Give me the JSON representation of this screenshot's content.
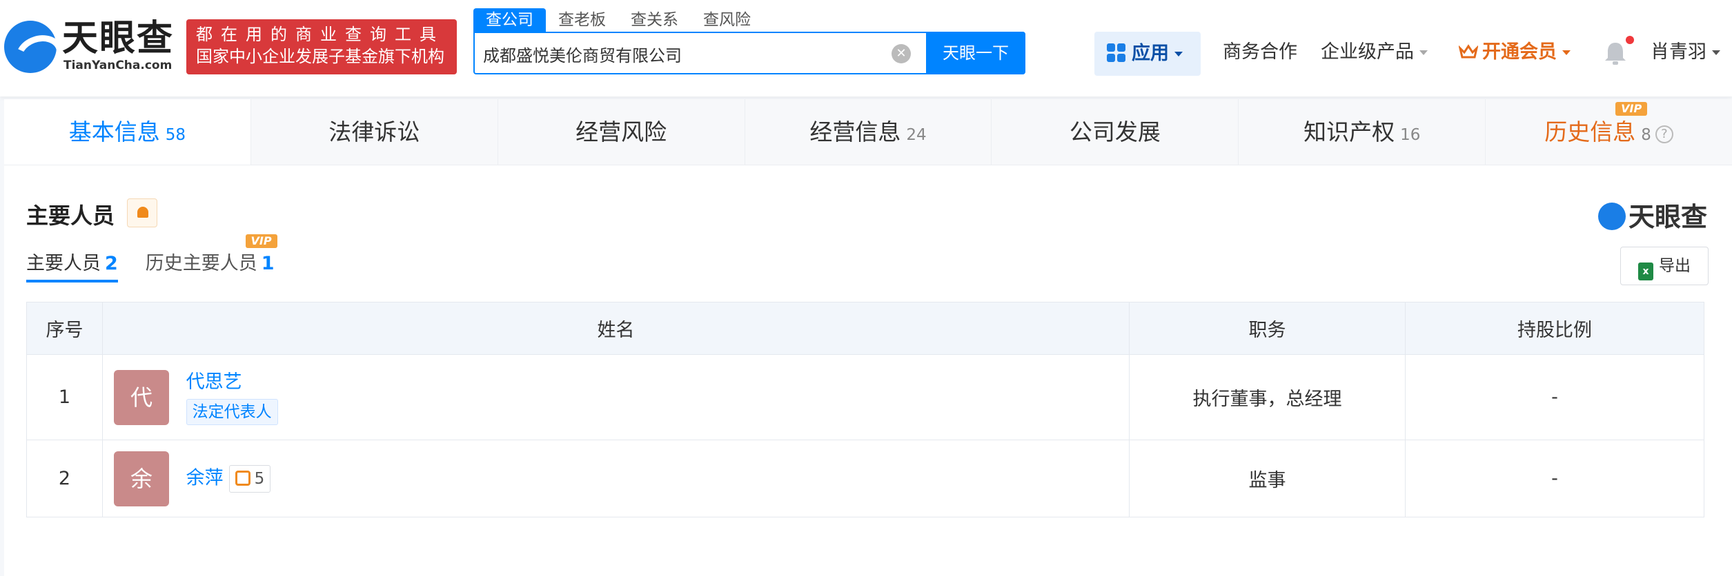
{
  "header": {
    "logo_text": "天眼查",
    "logo_sub": "TianYanCha.com",
    "banner_line1": "都在用的商业查询工具",
    "banner_line2": "国家中小企业发展子基金旗下机构",
    "search_tabs": [
      "查公司",
      "查老板",
      "查关系",
      "查风险"
    ],
    "search_value": "成都盛悦美伦商贸有限公司",
    "search_button": "天眼一下",
    "nav": {
      "apps": "应用",
      "business": "商务合作",
      "enterprise": "企业级产品",
      "vip": "开通会员",
      "user": "肖青羽"
    }
  },
  "tabs": [
    {
      "label": "基本信息",
      "count": "58"
    },
    {
      "label": "法律诉讼",
      "count": ""
    },
    {
      "label": "经营风险",
      "count": ""
    },
    {
      "label": "经营信息",
      "count": "24"
    },
    {
      "label": "公司发展",
      "count": ""
    },
    {
      "label": "知识产权",
      "count": "16"
    },
    {
      "label": "历史信息",
      "count": "8",
      "vip": "VIP"
    }
  ],
  "section": {
    "title": "主要人员",
    "brand": "天眼查",
    "subtabs": [
      {
        "label": "主要人员",
        "count": "2"
      },
      {
        "label": "历史主要人员",
        "count": "1",
        "vip": "VIP"
      }
    ],
    "export": "导出"
  },
  "table": {
    "headers": [
      "序号",
      "姓名",
      "职务",
      "持股比例"
    ],
    "rows": [
      {
        "index": "1",
        "avatar": "代",
        "name": "代思艺",
        "tag": "法定代表人",
        "position": "执行董事，总经理",
        "share": "-"
      },
      {
        "index": "2",
        "avatar": "余",
        "name": "余萍",
        "relation_count": "5",
        "position": "监事",
        "share": "-"
      }
    ]
  },
  "colors": {
    "primary": "#0084ff",
    "banner": "#d8393b",
    "vip_orange": "#e46a1a",
    "avatar": "#c98a8a"
  }
}
